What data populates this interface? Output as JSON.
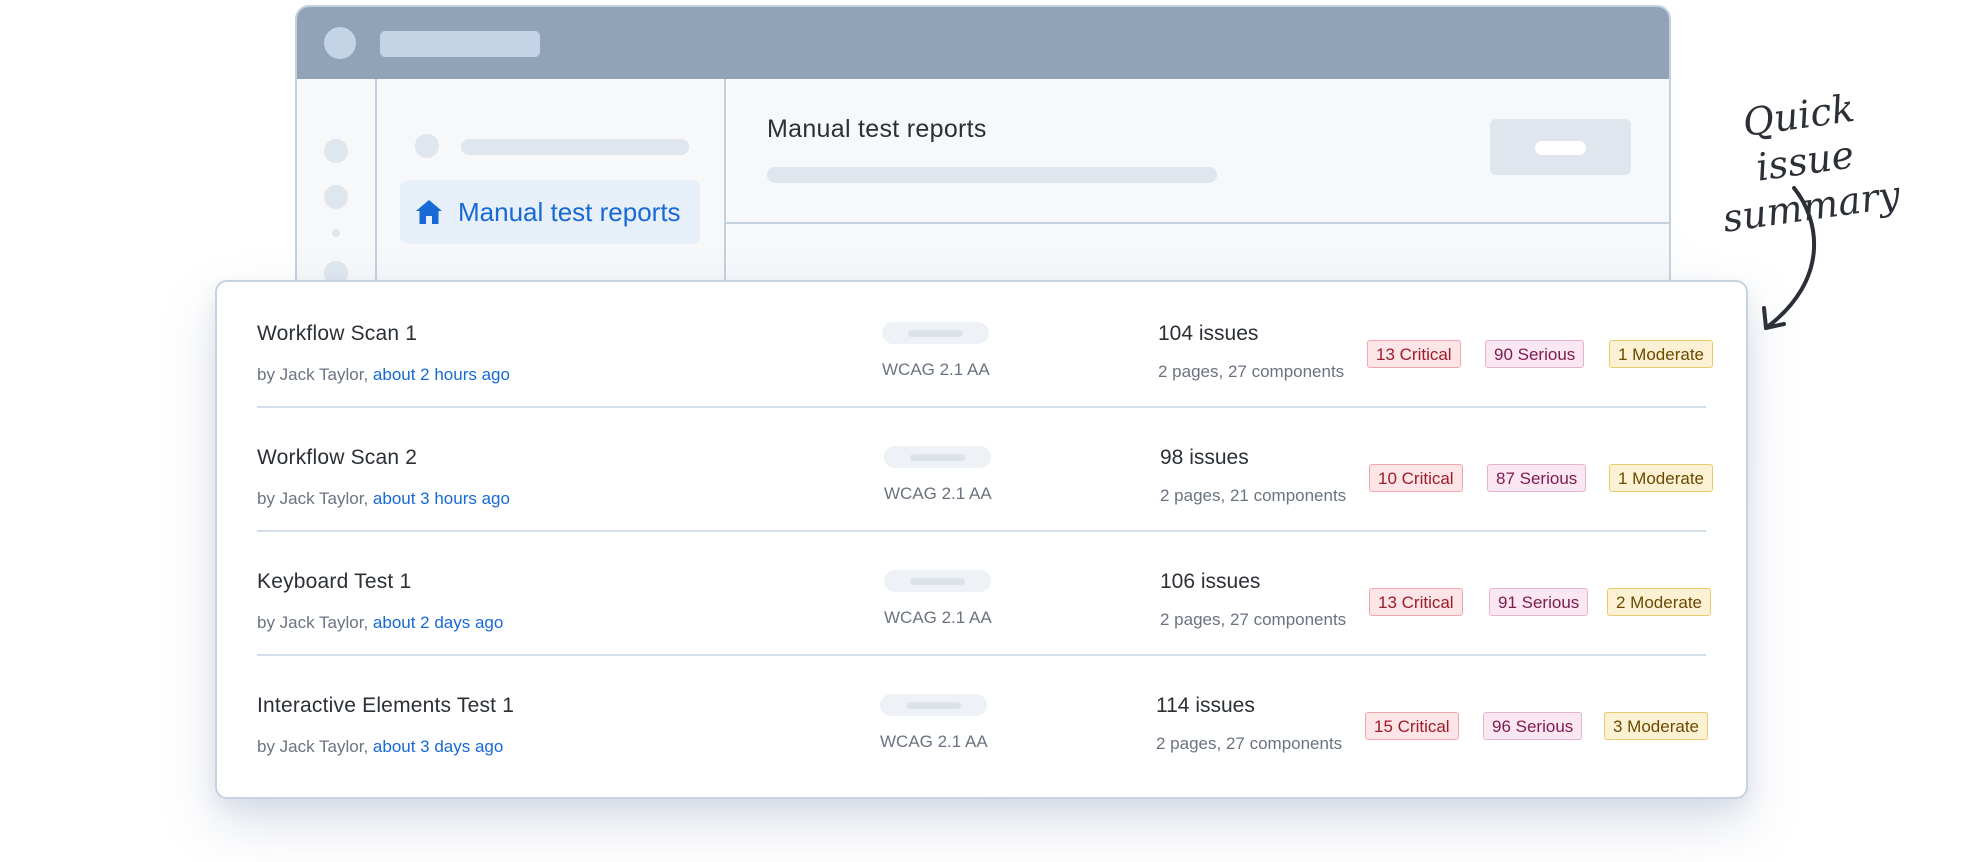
{
  "app": {
    "page_title": "Manual test reports",
    "nav_active_label": "Manual test reports",
    "nav_active_icon": "home-icon",
    "accent_color": "#1769d6"
  },
  "annotation": {
    "line1": "Quick issue",
    "line2": "summary"
  },
  "reports": [
    {
      "title": "Workflow Scan 1",
      "author_prefix": "by Jack Taylor, ",
      "time": "about 2 hours ago",
      "standard": "WCAG 2.1 AA",
      "issues": "104 issues",
      "pages": "2 pages, 27 components",
      "critical": "13 Critical",
      "serious": "90 Serious",
      "moderate": "1 Moderate"
    },
    {
      "title": "Workflow Scan 2",
      "author_prefix": "by Jack Taylor, ",
      "time": "about 3 hours ago",
      "standard": "WCAG 2.1 AA",
      "issues": "98 issues",
      "pages": "2 pages, 21 components",
      "critical": "10 Critical",
      "serious": "87 Serious",
      "moderate": "1 Moderate"
    },
    {
      "title": "Keyboard Test 1",
      "author_prefix": "by Jack Taylor, ",
      "time": "about 2 days ago",
      "standard": "WCAG 2.1 AA",
      "issues": "106 issues",
      "pages": "2 pages, 27 components",
      "critical": "13 Critical",
      "serious": "91 Serious",
      "moderate": "2 Moderate"
    },
    {
      "title": "Interactive Elements Test 1",
      "author_prefix": "by Jack Taylor, ",
      "time": "about 3 days ago",
      "standard": "WCAG 2.1 AA",
      "issues": "114 issues",
      "pages": "2 pages, 27 components",
      "critical": "15 Critical",
      "serious": "96 Serious",
      "moderate": "3 Moderate"
    }
  ]
}
